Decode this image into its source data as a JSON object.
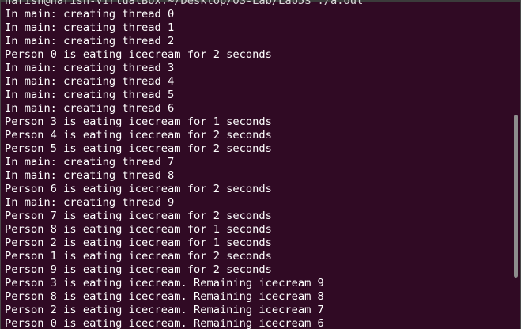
{
  "terminal": {
    "colors": {
      "background": "#300a24",
      "text": "#ffffff",
      "scrollbar": "#8d8d8d"
    },
    "prompt_line": "harish@harish-VirtualBox:~/Desktop/OS-Lab/Lab5$ ./a.out",
    "lines": [
      "In main: creating thread 0",
      "In main: creating thread 1",
      "In main: creating thread 2",
      "Person 0 is eating icecream for 2 seconds",
      "In main: creating thread 3",
      "In main: creating thread 4",
      "In main: creating thread 5",
      "In main: creating thread 6",
      "Person 3 is eating icecream for 1 seconds",
      "Person 4 is eating icecream for 2 seconds",
      "Person 5 is eating icecream for 2 seconds",
      "In main: creating thread 7",
      "In main: creating thread 8",
      "Person 6 is eating icecream for 2 seconds",
      "In main: creating thread 9",
      "Person 7 is eating icecream for 2 seconds",
      "Person 8 is eating icecream for 1 seconds",
      "Person 2 is eating icecream for 1 seconds",
      "Person 1 is eating icecream for 2 seconds",
      "Person 9 is eating icecream for 2 seconds",
      "Person 3 is eating icecream. Remaining icecream 9",
      "Person 8 is eating icecream. Remaining icecream 8",
      "Person 2 is eating icecream. Remaining icecream 7",
      "Person 0 is eating icecream. Remaining icecream 6"
    ]
  }
}
